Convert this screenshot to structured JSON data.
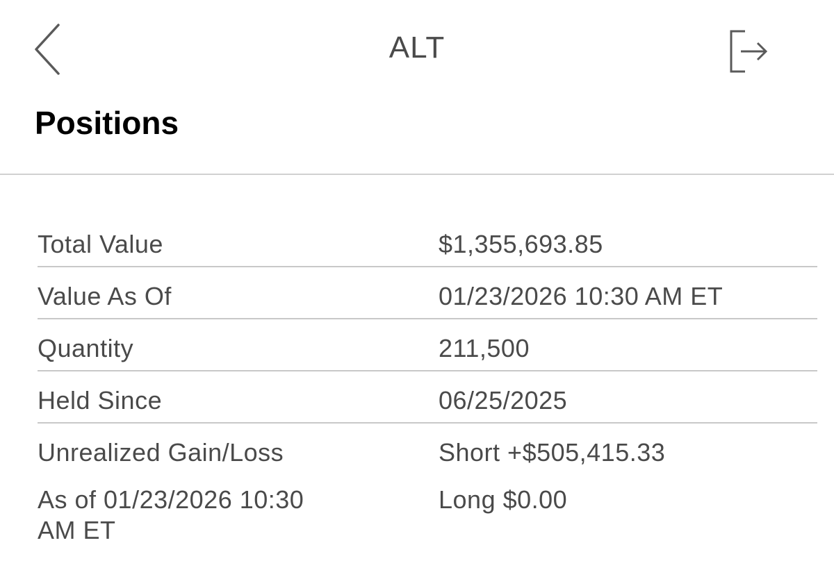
{
  "nav": {
    "title": "ALT",
    "back_icon": "chevron-left-icon",
    "exit_icon": "exit-icon"
  },
  "section": {
    "title": "Positions"
  },
  "details": [
    {
      "label": "Total Value",
      "value": "$1,355,693.85"
    },
    {
      "label": "Value As Of",
      "value": "01/23/2026 10:30 AM ET"
    },
    {
      "label": "Quantity",
      "value": "211,500"
    },
    {
      "label": "Held Since",
      "value": "06/25/2025"
    },
    {
      "label": "Unrealized Gain/Loss",
      "value": "Short +$505,415.33"
    },
    {
      "label": "As of 01/23/2026 10:30 AM ET",
      "value": "Long $0.00"
    }
  ],
  "colors": {
    "text": "#4a4a4a",
    "heading": "#000000",
    "divider": "#c8c8c8",
    "background": "#ffffff"
  }
}
